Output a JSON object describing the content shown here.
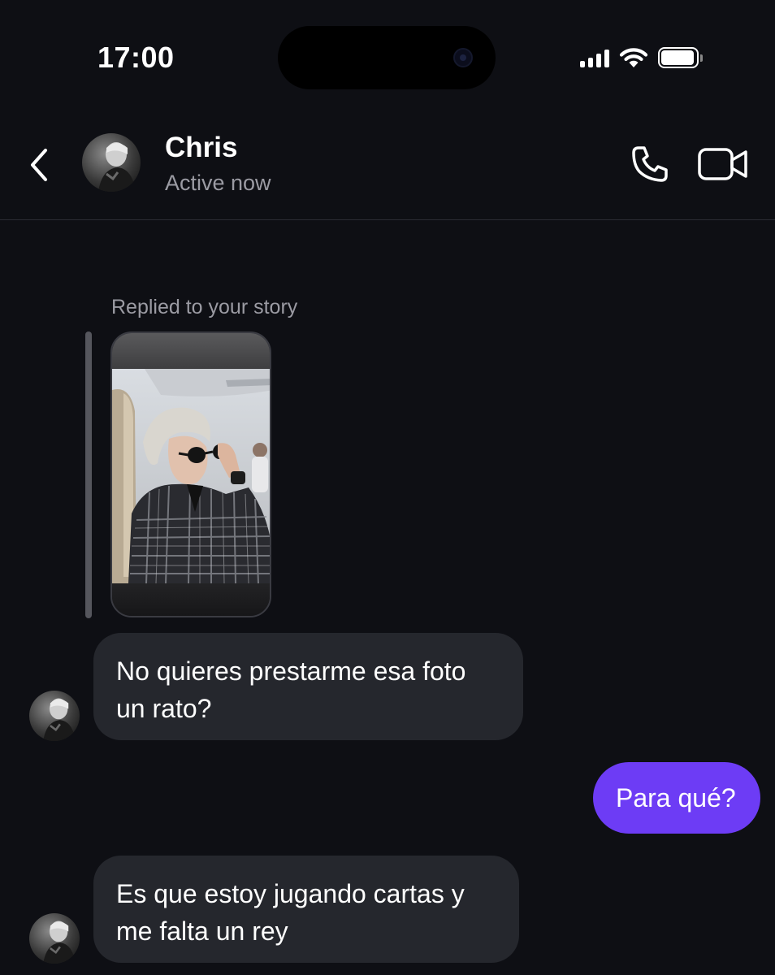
{
  "status_bar": {
    "time": "17:00"
  },
  "header": {
    "contact_name": "Chris",
    "contact_status": "Active now",
    "icons": [
      "back-chevron-icon",
      "phone-icon",
      "video-camera-icon"
    ]
  },
  "story_reply": {
    "caption": "Replied to your story"
  },
  "messages": [
    {
      "from": "contact",
      "text_lines": [
        "No quieres prestarme esa foto",
        "un rato?"
      ]
    },
    {
      "from": "me",
      "text_lines": [
        "Para qué?"
      ]
    },
    {
      "from": "contact",
      "text_lines": [
        "Es que estoy jugando cartas y",
        "me falta un rey"
      ]
    }
  ],
  "colors": {
    "background": "#0e0f14",
    "incoming_bubble": "#25272d",
    "outgoing_bubble": "#6d3cf5",
    "secondary_text": "#9b9ba3"
  }
}
